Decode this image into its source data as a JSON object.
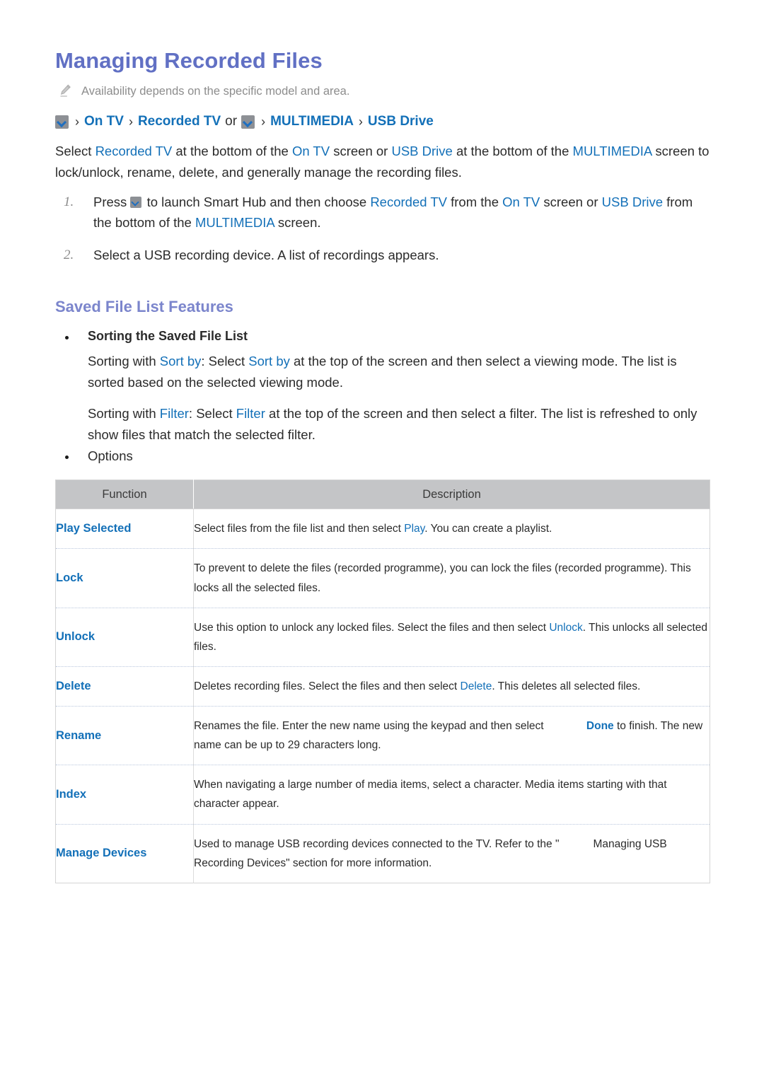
{
  "document": {
    "title": "Managing Recorded Files",
    "note": {
      "icon": "pencil-icon",
      "text": "Availability depends on the specific model and area."
    },
    "path": {
      "icon": "smart-hub-chevron-icon",
      "item1": "On TV",
      "item2": "Recorded TV",
      "conjunction": "or",
      "item3": "MULTIMEDIA",
      "item4": "USB Drive",
      "separator": "›"
    },
    "intro": {
      "p1_a": "Select ",
      "p1_b": "Recorded TV",
      "p1_c": " at the bottom of the ",
      "p1_d": "On TV",
      "p1_e": " screen or ",
      "p1_f": "USB Drive",
      "p1_g": " at the bottom of the ",
      "p1_h": "MULTIMEDIA",
      "p1_i": " screen to lock/unlock, rename, delete, and generally manage the recording files."
    },
    "steps": [
      {
        "num": "1.",
        "a": "Press ",
        "b": " to launch Smart Hub and then choose ",
        "c": "Recorded TV",
        "d": " from the ",
        "e": "On TV",
        "f": " screen or ",
        "g": "USB Drive",
        "h": " from the bottom of the ",
        "i": "MULTIMEDIA",
        "j": " screen."
      },
      {
        "num": "2.",
        "a": "Select a USB recording device. A list of recordings appears.",
        "b": "",
        "c": "",
        "d": "",
        "e": "",
        "f": "",
        "g": "",
        "h": "",
        "i": "",
        "j": ""
      }
    ],
    "section": {
      "title": "Saved File List Features",
      "bullet1": "Sorting the Saved File List",
      "sort_by": {
        "a": "Sorting with ",
        "b": "Sort by",
        "c": ": Select ",
        "d": "Sort by",
        "e": " at the top of the screen and then select a viewing mode. The list is sorted based on the selected viewing mode."
      },
      "filter": {
        "a": "Sorting with ",
        "b": "Filter",
        "c": ": Select ",
        "d": "Filter",
        "e": " at the top of the screen and then select a filter. The list is refreshed to only show files that match the selected filter."
      },
      "bullet2": "Options"
    },
    "table": {
      "headers": [
        "Function",
        "Description"
      ],
      "rows": [
        {
          "function": "Play Selected",
          "desc_a": "Select files from the file list and then select ",
          "desc_link": "Play",
          "desc_b": ". You can create a playlist.",
          "desc_c": "",
          "desc_link2": "",
          "desc_d": ""
        },
        {
          "function": "Lock",
          "desc_a": "To prevent to delete the files (recorded programme), you can lock the files (recorded programme). This locks all the selected files.",
          "desc_link": "",
          "desc_b": "",
          "desc_c": "",
          "desc_link2": "",
          "desc_d": ""
        },
        {
          "function": "Unlock",
          "desc_a": "Use this option to unlock any locked files. Select the files and then select ",
          "desc_link": "Unlock",
          "desc_b": ". This unlocks all selected files.",
          "desc_c": "",
          "desc_link2": "",
          "desc_d": ""
        },
        {
          "function": "Delete",
          "desc_a": "Deletes recording files. Select the files and then select ",
          "desc_link": "Delete",
          "desc_b": ". This deletes all selected files.",
          "desc_c": "",
          "desc_link2": "",
          "desc_d": ""
        },
        {
          "function": "Rename",
          "desc_a": "Renames the file. Enter the new name using the keypad and then select ",
          "desc_link": "Done",
          "desc_b": " to finish. The new name can be up to 29 characters long.",
          "desc_c": "",
          "desc_link2": "",
          "desc_d": ""
        },
        {
          "function": "Index",
          "desc_a": "When navigating a large number of media items, select a character. Media items starting with that character appear.",
          "desc_link": "",
          "desc_b": "",
          "desc_c": "",
          "desc_link2": "",
          "desc_d": ""
        },
        {
          "function": "Manage Devices",
          "desc_a": "Used to manage USB recording devices connected to the TV. Refer to the \"",
          "desc_link": "",
          "desc_b": "Managing",
          "desc_c": " USB Recording Devices\" section for more information.",
          "desc_link2": "",
          "desc_d": ""
        }
      ]
    }
  },
  "colors": {
    "title": "#6170c4",
    "section_title": "#7b85cc",
    "link_blue": "#1370b8",
    "note_grey": "#8d8d8d",
    "table_header_bg": "#c4c5c7"
  }
}
